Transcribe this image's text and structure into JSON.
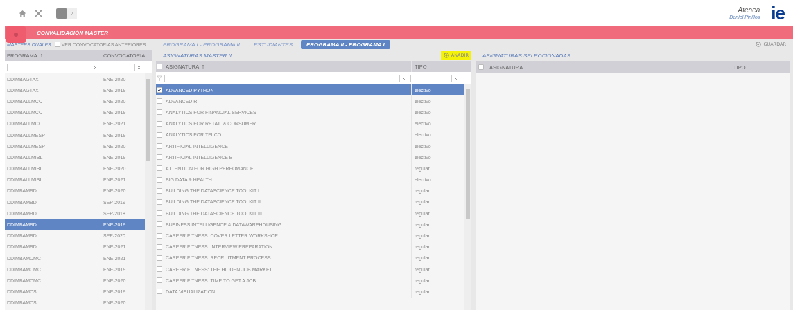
{
  "header": {
    "app_name": "Atenea",
    "user": "Daniel Pinillos",
    "logo": "ie"
  },
  "title_bar": {
    "title": "CONVALIDACIÓN MASTER"
  },
  "left_panel": {
    "title": "MASTERS DUALES",
    "option": {
      "label": "VER CONVOCATORIAS ANTERIORES",
      "checked": false
    },
    "columns": [
      "PROGRAMA",
      "CONVOCATORIA"
    ],
    "rows": [
      {
        "programa": "DDIMBAGTAX",
        "convocatoria": "ENE-2020",
        "selected": false
      },
      {
        "programa": "DDIMBAGTAX",
        "convocatoria": "ENE-2019",
        "selected": false
      },
      {
        "programa": "DDIMBALLMCC",
        "convocatoria": "ENE-2020",
        "selected": false
      },
      {
        "programa": "DDIMBALLMCC",
        "convocatoria": "ENE-2019",
        "selected": false
      },
      {
        "programa": "DDIMBALLMCC",
        "convocatoria": "ENE-2021",
        "selected": false
      },
      {
        "programa": "DDIMBALLMESP",
        "convocatoria": "ENE-2019",
        "selected": false
      },
      {
        "programa": "DDIMBALLMESP",
        "convocatoria": "ENE-2020",
        "selected": false
      },
      {
        "programa": "DDIMBALLMIBL",
        "convocatoria": "ENE-2019",
        "selected": false
      },
      {
        "programa": "DDIMBALLMIBL",
        "convocatoria": "ENE-2020",
        "selected": false
      },
      {
        "programa": "DDIMBALLMIBL",
        "convocatoria": "ENE-2021",
        "selected": false
      },
      {
        "programa": "DDIMBAMBD",
        "convocatoria": "ENE-2020",
        "selected": false
      },
      {
        "programa": "DDIMBAMBD",
        "convocatoria": "SEP-2019",
        "selected": false
      },
      {
        "programa": "DDIMBAMBD",
        "convocatoria": "SEP-2018",
        "selected": false
      },
      {
        "programa": "DDIMBAMBD",
        "convocatoria": "ENE-2019",
        "selected": true
      },
      {
        "programa": "DDIMBAMBD",
        "convocatoria": "SEP-2020",
        "selected": false
      },
      {
        "programa": "DDIMBAMBD",
        "convocatoria": "ENE-2021",
        "selected": false
      },
      {
        "programa": "DDIMBAMCMC",
        "convocatoria": "ENE-2021",
        "selected": false
      },
      {
        "programa": "DDIMBAMCMC",
        "convocatoria": "ENE-2019",
        "selected": false
      },
      {
        "programa": "DDIMBAMCMC",
        "convocatoria": "ENE-2020",
        "selected": false
      },
      {
        "programa": "DDIMBAMCS",
        "convocatoria": "ENE-2019",
        "selected": false
      },
      {
        "programa": "DDIMBAMCS",
        "convocatoria": "ENE-2020",
        "selected": false
      }
    ]
  },
  "tabs": [
    {
      "label": "PROGRAMA I - PROGRAMA II",
      "selected": false
    },
    {
      "label": "ESTUDIANTES",
      "selected": false
    },
    {
      "label": "PROGRAMA II - PROGRAMA I",
      "selected": true
    }
  ],
  "save_button": "GUARDAR",
  "subjects": {
    "title": "ASIGNATURAS MÁSTER II",
    "add_button": "AÑADIR",
    "columns": [
      "ASIGNATURA",
      "TIPO"
    ],
    "all_checked": false,
    "rows": [
      {
        "name": "ADVANCED PYTHON",
        "tipo": "electivo",
        "checked": true,
        "selected": true
      },
      {
        "name": "ADVANCED R",
        "tipo": "electivo",
        "checked": false,
        "selected": false
      },
      {
        "name": "ANALYTICS FOR FINANCIAL SERVICES",
        "tipo": "electivo",
        "checked": false,
        "selected": false
      },
      {
        "name": "ANALYTICS FOR RETAIL & CONSUMER",
        "tipo": "electivo",
        "checked": false,
        "selected": false
      },
      {
        "name": "ANALYTICS FOR TELCO",
        "tipo": "electivo",
        "checked": false,
        "selected": false
      },
      {
        "name": "ARTIFICIAL INTELLIGENCE",
        "tipo": "electivo",
        "checked": false,
        "selected": false
      },
      {
        "name": "ARTIFICIAL INTELLIGENCE B",
        "tipo": "electivo",
        "checked": false,
        "selected": false
      },
      {
        "name": "ATTENTION FOR HIGH PERFOMANCE",
        "tipo": "regular",
        "checked": false,
        "selected": false
      },
      {
        "name": "BIG DATA & HEALTH",
        "tipo": "electivo",
        "checked": false,
        "selected": false
      },
      {
        "name": "BUILDING THE DATASCIENCE TOOLKIT I",
        "tipo": "regular",
        "checked": false,
        "selected": false
      },
      {
        "name": "BUILDING THE DATASCIENCE TOOLKIT II",
        "tipo": "regular",
        "checked": false,
        "selected": false
      },
      {
        "name": "BUILDING THE DATASCIENCE TOOLKIT III",
        "tipo": "regular",
        "checked": false,
        "selected": false
      },
      {
        "name": "BUSINESS INTELLIGENCE & DATAWAREHOUSING",
        "tipo": "regular",
        "checked": false,
        "selected": false
      },
      {
        "name": "CAREER FITNESS: COVER LETTER WORKSHOP",
        "tipo": "regular",
        "checked": false,
        "selected": false
      },
      {
        "name": "CAREER FITNESS: INTERVIEW PREPARATION",
        "tipo": "regular",
        "checked": false,
        "selected": false
      },
      {
        "name": "CAREER FITNESS: RECRUITMENT PROCESS",
        "tipo": "regular",
        "checked": false,
        "selected": false
      },
      {
        "name": "CAREER FITNESS: THE HIDDEN JOB MARKET",
        "tipo": "regular",
        "checked": false,
        "selected": false
      },
      {
        "name": "CAREER FITNESS: TIME TO GET A JOB",
        "tipo": "regular",
        "checked": false,
        "selected": false
      },
      {
        "name": "DATA VISUALIZATION",
        "tipo": "regular",
        "checked": false,
        "selected": false
      }
    ]
  },
  "selected_subjects": {
    "title": "ASIGNATURAS SELECCIONADAS",
    "columns": [
      "ASIGNATURA",
      "TIPO"
    ],
    "all_checked": false
  }
}
